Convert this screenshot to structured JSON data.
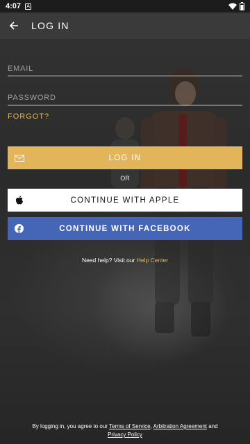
{
  "status_bar": {
    "time": "4:07",
    "notification_icon": "A"
  },
  "header": {
    "title": "LOG IN"
  },
  "form": {
    "email_placeholder": "EMAIL",
    "password_placeholder": "PASSWORD",
    "forgot_label": "FORGOT?"
  },
  "buttons": {
    "login_label": "LOG IN",
    "or_label": "OR",
    "apple_label": "CONTINUE WITH APPLE",
    "facebook_label": "CONTINUE WITH FACEBOOK"
  },
  "help": {
    "prefix": "Need help? Visit our ",
    "link": "Help Center"
  },
  "legal": {
    "prefix": "By logging in, you agree to our ",
    "terms": "Terms of Service",
    "comma": ", ",
    "arbitration": "Arbitration Agreement",
    "and": " and",
    "privacy": "Privacy Policy"
  },
  "colors": {
    "accent": "#e2b55a",
    "facebook": "#4565b6"
  }
}
